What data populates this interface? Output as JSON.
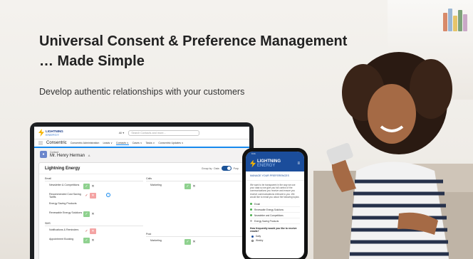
{
  "headline": {
    "line1": "Universal Consent & Preference Management",
    "line2": "… Made Simple"
  },
  "subheadline": "Develop authentic relationships with your customers",
  "laptop": {
    "brand": {
      "line1": "LIGHTNING",
      "line2": "ENERGY"
    },
    "search": {
      "scope": "All ▾",
      "placeholder": "Search Contacts and more..."
    },
    "nav": {
      "app_name": "Consentric",
      "items": [
        "Consentric Administration",
        "Leads ∨",
        "Contacts ∨",
        "Cases ∨",
        "Tasks ∨",
        "Consentric Updates ∨"
      ]
    },
    "record": {
      "type": "Contact",
      "name": "Mr. Henry Herman",
      "action": "A"
    },
    "card": {
      "title": "Lightning Energy",
      "group_by": "Group by : Data",
      "purpose_label": "Purp",
      "left_sections": [
        {
          "name": "Email",
          "rows": [
            {
              "label": "Newsletter & Competitions",
              "state": "yes"
            },
            {
              "label": "Recommended Cost Saving Tariffs",
              "state": "no",
              "info": true
            },
            {
              "label": "Energy Saving Products",
              "state": "none"
            },
            {
              "label": "Renewable Energy Solutions",
              "state": "yes"
            }
          ]
        },
        {
          "name": "SMS",
          "rows": [
            {
              "label": "Notifications & Reminders",
              "state": "no"
            },
            {
              "label": "Appointment Booking",
              "state": "yes"
            }
          ]
        }
      ],
      "right_sections": [
        {
          "name": "Calls",
          "rows": [
            {
              "label": "Marketing",
              "state": "yes"
            }
          ]
        },
        {
          "name": "Post",
          "rows": [
            {
              "label": "Marketing",
              "state": "yes"
            }
          ]
        }
      ]
    }
  },
  "phone": {
    "status": "9:41",
    "brand": {
      "line1": "LIGHTNING",
      "line2": "ENERGY"
    },
    "title": "MANAGE YOUR PREFERENCES",
    "body": "We want to be transparent in the way we use your data so we give you full control of the communications you receive and ensure you receive communications relevant to you. We would like to email you about the following topics",
    "toggle_label": "Email",
    "topics": [
      {
        "label": "Renewable Energy Solutions",
        "on": true
      },
      {
        "label": "Newsletter and Competitions",
        "on": true
      },
      {
        "label": "Energy Saving Products",
        "on": false
      }
    ],
    "question": "How frequently would you like to receive emails?",
    "options": [
      {
        "label": "Daily",
        "on": true
      },
      {
        "label": "Weekly",
        "on": false
      }
    ]
  },
  "colors": {
    "headline": "#222222",
    "brand_blue": "#1b4d9b",
    "accent_blue": "#1589ee",
    "check_green": "#8fd18f",
    "cross_red": "#f4a3a3",
    "bolt_yellow": "#f5b400"
  }
}
